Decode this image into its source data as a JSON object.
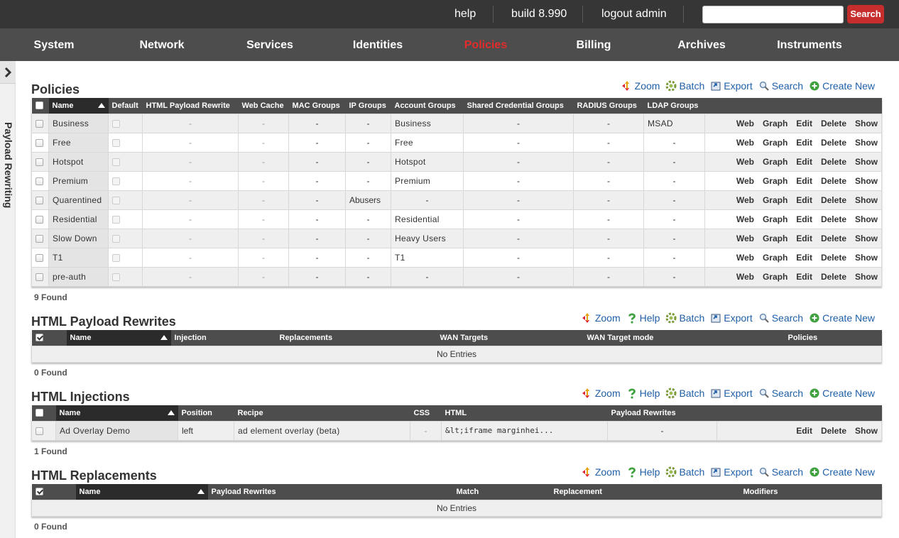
{
  "topbar": {
    "help": "help",
    "build": "build 8.990",
    "logout": "logout admin",
    "search_value": "",
    "search_button": "Search"
  },
  "nav": [
    "System",
    "Network",
    "Services",
    "Identities",
    "Policies",
    "Billing",
    "Archives",
    "Instruments"
  ],
  "nav_active": "Policies",
  "sidebar": {
    "label": "Payload Rewriting"
  },
  "policies": {
    "title": "Policies",
    "actions": [
      "Zoom",
      "Batch",
      "Export",
      "Search",
      "Create New"
    ],
    "columns": [
      "Name",
      "Default",
      "HTML Payload Rewrite",
      "Web Cache",
      "MAC Groups",
      "IP Groups",
      "Account Groups",
      "Shared Credential Groups",
      "RADIUS Groups",
      "LDAP Groups"
    ],
    "rows": [
      [
        "Business",
        "-",
        "-",
        "-",
        "-",
        "Business",
        "-",
        "-",
        "MSAD"
      ],
      [
        "Free",
        "-",
        "-",
        "-",
        "-",
        "Free",
        "-",
        "-",
        "-"
      ],
      [
        "Hotspot",
        "-",
        "-",
        "-",
        "-",
        "Hotspot",
        "-",
        "-",
        "-"
      ],
      [
        "Premium",
        "-",
        "-",
        "-",
        "-",
        "Premium",
        "-",
        "-",
        "-"
      ],
      [
        "Quarentined",
        "-",
        "-",
        "-",
        "Abusers",
        "-",
        "-",
        "-",
        "-"
      ],
      [
        "Residential",
        "-",
        "-",
        "-",
        "-",
        "Residential",
        "-",
        "-",
        "-"
      ],
      [
        "Slow Down",
        "-",
        "-",
        "-",
        "-",
        "Heavy Users",
        "-",
        "-",
        "-"
      ],
      [
        "T1",
        "-",
        "-",
        "-",
        "-",
        "T1",
        "-",
        "-",
        "-"
      ],
      [
        "pre-auth",
        "-",
        "-",
        "-",
        "-",
        "-",
        "-",
        "-",
        "-"
      ]
    ],
    "row_actions": [
      "Web",
      "Graph",
      "Edit",
      "Delete",
      "Show"
    ],
    "found": "9 Found"
  },
  "rewrites": {
    "title": "HTML Payload Rewrites",
    "actions": [
      "Zoom",
      "Help",
      "Batch",
      "Export",
      "Search",
      "Create New"
    ],
    "columns": [
      "Name",
      "Injection",
      "Replacements",
      "WAN Targets",
      "WAN Target mode",
      "Policies"
    ],
    "empty": "No Entries",
    "found": "0 Found"
  },
  "injections": {
    "title": "HTML Injections",
    "actions": [
      "Zoom",
      "Help",
      "Batch",
      "Export",
      "Search",
      "Create New"
    ],
    "columns": [
      "Name",
      "Position",
      "Recipe",
      "CSS",
      "HTML",
      "Payload Rewrites"
    ],
    "rows": [
      [
        "Ad Overlay Demo",
        "left",
        "ad element overlay (beta)",
        "-",
        "&lt;iframe marginhei...",
        "-"
      ]
    ],
    "row_actions": [
      "Edit",
      "Delete",
      "Show"
    ],
    "found": "1 Found"
  },
  "replacements": {
    "title": "HTML Replacements",
    "actions": [
      "Zoom",
      "Help",
      "Batch",
      "Export",
      "Search",
      "Create New"
    ],
    "columns": [
      "Name",
      "Payload Rewrites",
      "Match",
      "Replacement",
      "Modifiers"
    ],
    "empty": "No Entries",
    "found": "0 Found"
  },
  "colors": {
    "accent_red": "#c62d2d",
    "active_nav": "#e42b2b",
    "link_blue": "#1f5fa8",
    "header_dark": "#4d4d4d"
  },
  "icons": {
    "Zoom": "zoom-arrows-icon",
    "Help": "question-icon",
    "Batch": "gear-icon",
    "Export": "export-icon",
    "Search": "magnifier-icon",
    "Create New": "plus-circle-icon"
  }
}
